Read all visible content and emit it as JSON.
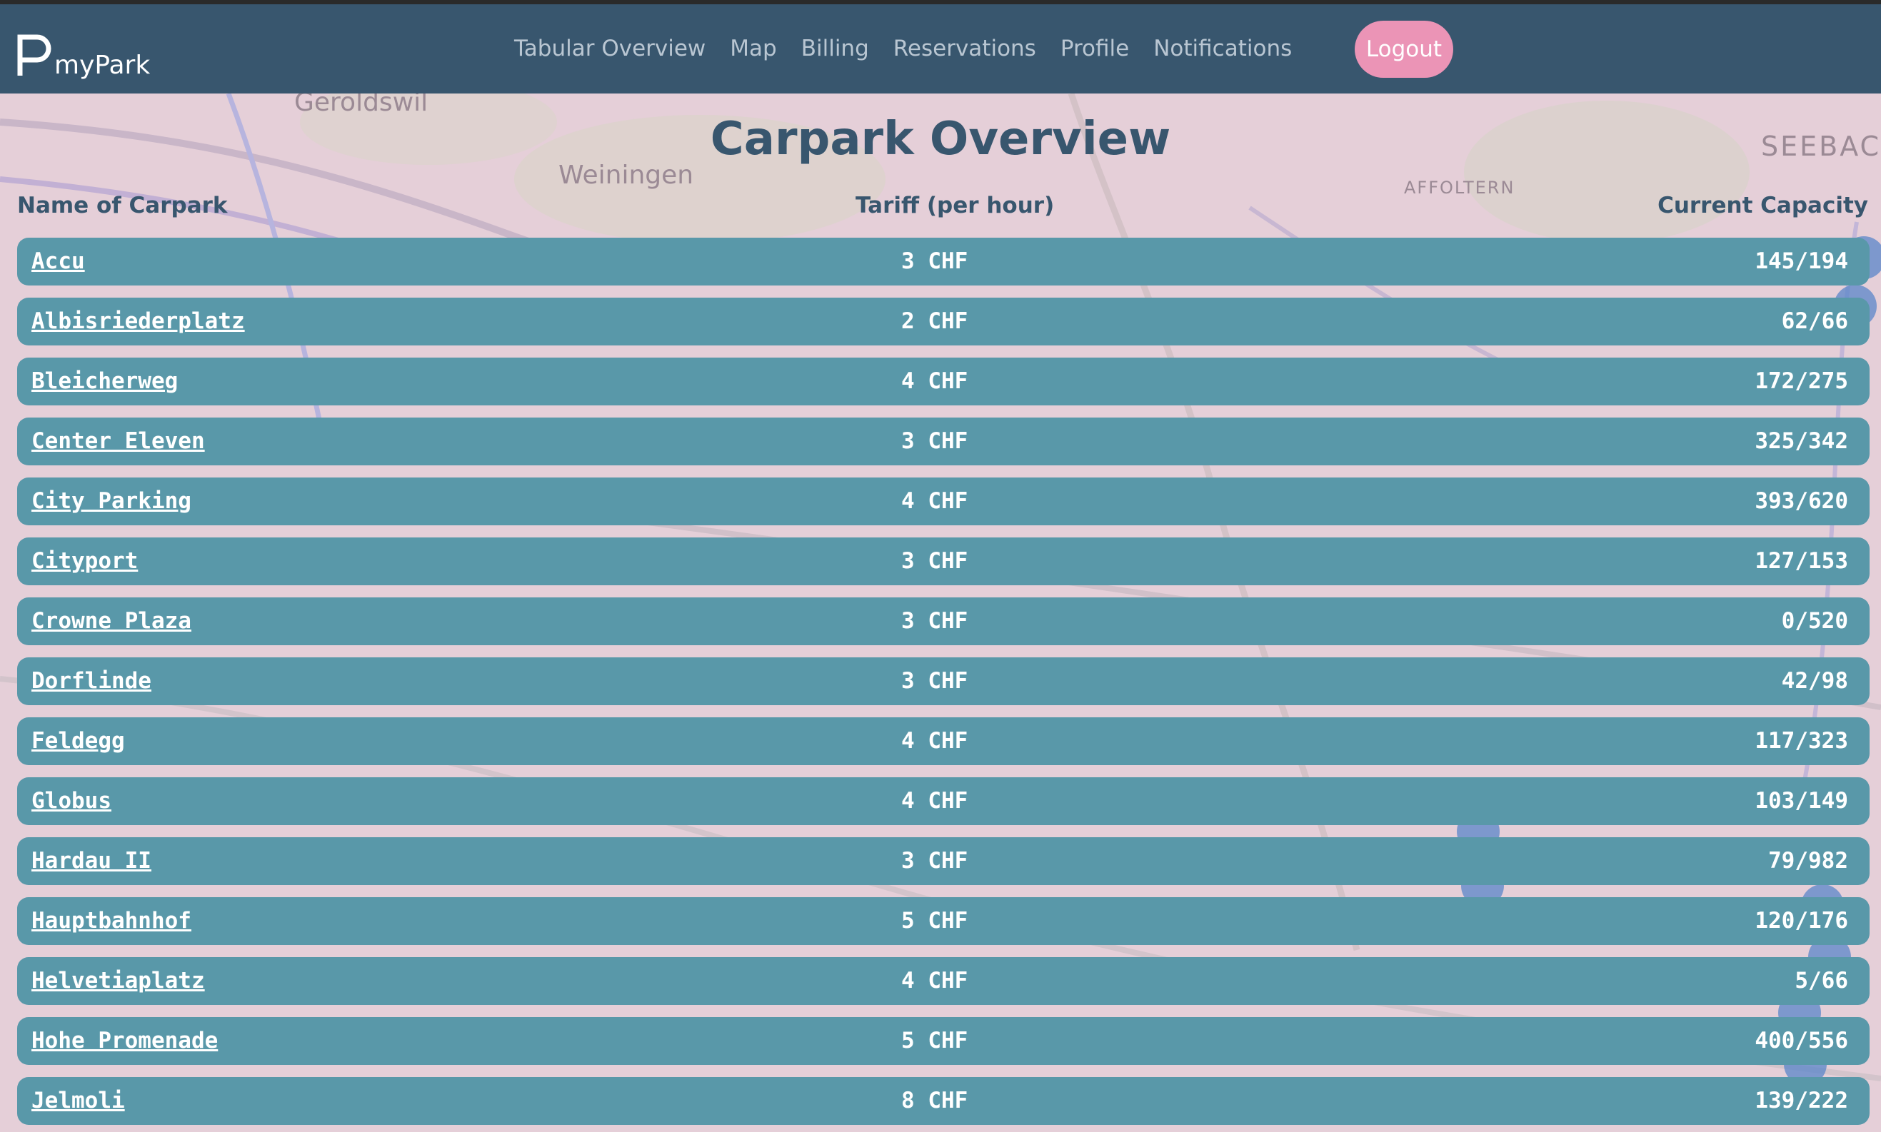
{
  "brand": {
    "logo_icon": "parking-logo-icon",
    "name": "myPark"
  },
  "nav": {
    "links": [
      {
        "label": "Tabular Overview"
      },
      {
        "label": "Map"
      },
      {
        "label": "Billing"
      },
      {
        "label": "Reservations"
      },
      {
        "label": "Profile"
      },
      {
        "label": "Notifications"
      }
    ],
    "logout_label": "Logout"
  },
  "map_labels": [
    "Geroldswil",
    "Weiningen",
    "AFFOLTERN",
    "SEEBAC"
  ],
  "title": "Carpark Overview",
  "table": {
    "headers": {
      "name": "Name of Carpark",
      "tariff": "Tariff (per hour)",
      "capacity": "Current Capacity"
    },
    "rows": [
      {
        "name": "Accu",
        "tariff": "3 CHF",
        "capacity": "145/194"
      },
      {
        "name": "Albisriederplatz",
        "tariff": "2 CHF",
        "capacity": "62/66"
      },
      {
        "name": "Bleicherweg",
        "tariff": "4 CHF",
        "capacity": "172/275"
      },
      {
        "name": "Center Eleven",
        "tariff": "3 CHF",
        "capacity": "325/342"
      },
      {
        "name": "City Parking",
        "tariff": "4 CHF",
        "capacity": "393/620"
      },
      {
        "name": "Cityport",
        "tariff": "3 CHF",
        "capacity": "127/153"
      },
      {
        "name": "Crowne Plaza",
        "tariff": "3 CHF",
        "capacity": "0/520"
      },
      {
        "name": "Dorflinde",
        "tariff": "3 CHF",
        "capacity": "42/98"
      },
      {
        "name": "Feldegg",
        "tariff": "4 CHF",
        "capacity": "117/323"
      },
      {
        "name": "Globus",
        "tariff": "4 CHF",
        "capacity": "103/149"
      },
      {
        "name": "Hardau II",
        "tariff": "3 CHF",
        "capacity": "79/982"
      },
      {
        "name": "Hauptbahnhof",
        "tariff": "5 CHF",
        "capacity": "120/176"
      },
      {
        "name": "Helvetiaplatz",
        "tariff": "4 CHF",
        "capacity": "5/66"
      },
      {
        "name": "Hohe Promenade",
        "tariff": "5 CHF",
        "capacity": "400/556"
      },
      {
        "name": "Jelmoli",
        "tariff": "8 CHF",
        "capacity": "139/222"
      }
    ]
  },
  "colors": {
    "navbar": "#38566e",
    "row": "#5998a9",
    "logout": "#eb94b6",
    "title": "#38566e",
    "map_tint": "#e5cfd8"
  }
}
